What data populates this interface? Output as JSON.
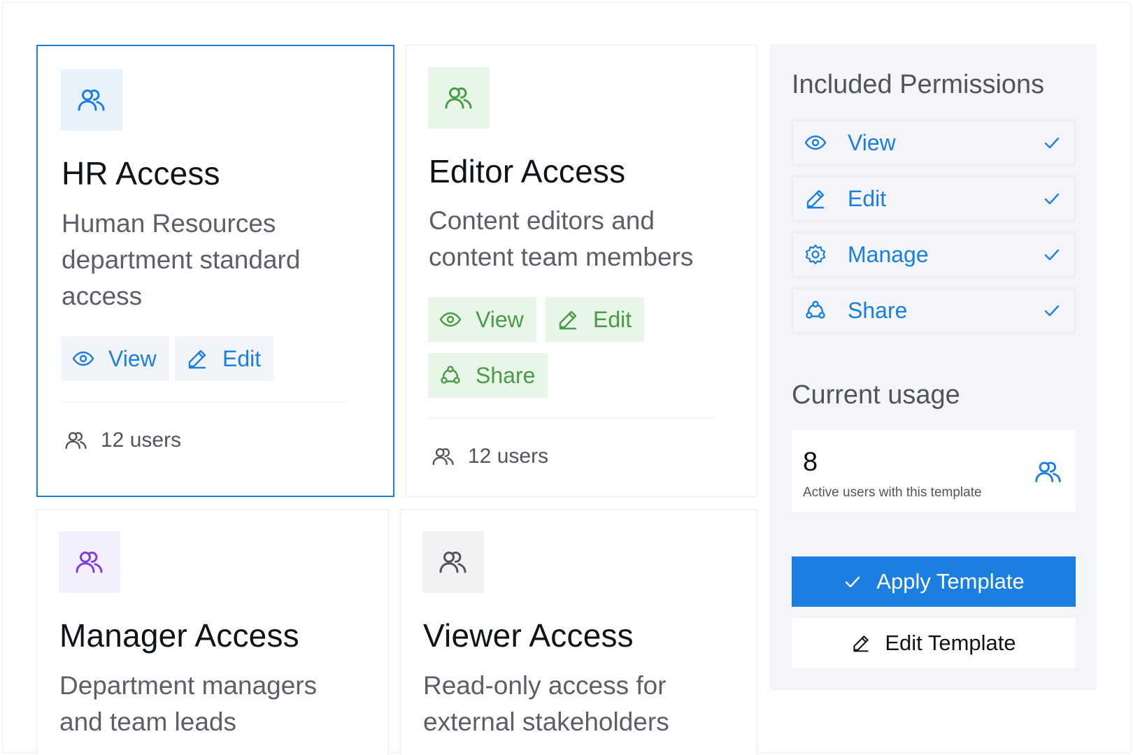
{
  "colors": {
    "accent": "#1a7fe0",
    "green": "#4a9a4a",
    "purple": "#7b3fe4",
    "gray_icon": "#50555c"
  },
  "templates": [
    {
      "title": "HR Access",
      "description": "Human Resources department standard access",
      "icon": "users-icon",
      "chips": [
        {
          "label": "View",
          "icon": "eye-icon"
        },
        {
          "label": "Edit",
          "icon": "pencil-icon"
        }
      ],
      "users": "12 users",
      "selected": true
    },
    {
      "title": "Editor Access",
      "description": "Content editors and content team members",
      "icon": "users-icon",
      "chips": [
        {
          "label": "View",
          "icon": "eye-icon"
        },
        {
          "label": "Edit",
          "icon": "pencil-icon"
        },
        {
          "label": "Share",
          "icon": "share-icon"
        }
      ],
      "users": "12 users"
    },
    {
      "title": "Manager Access",
      "description": "Department managers and team leads",
      "icon": "users-icon"
    },
    {
      "title": "Viewer Access",
      "description": "Read-only access for external stakeholders",
      "icon": "users-icon"
    }
  ],
  "panel": {
    "heading": "Included Permissions",
    "permissions": [
      {
        "label": "View",
        "icon": "eye-icon",
        "included": true
      },
      {
        "label": "Edit",
        "icon": "pencil-icon",
        "included": true
      },
      {
        "label": "Manage",
        "icon": "gear-icon",
        "included": true
      },
      {
        "label": "Share",
        "icon": "share-icon",
        "included": true
      }
    ],
    "usage_heading": "Current usage",
    "usage_count": "8",
    "usage_label": "Active users with this template",
    "apply_label": "Apply Template",
    "edit_label": "Edit Template"
  }
}
